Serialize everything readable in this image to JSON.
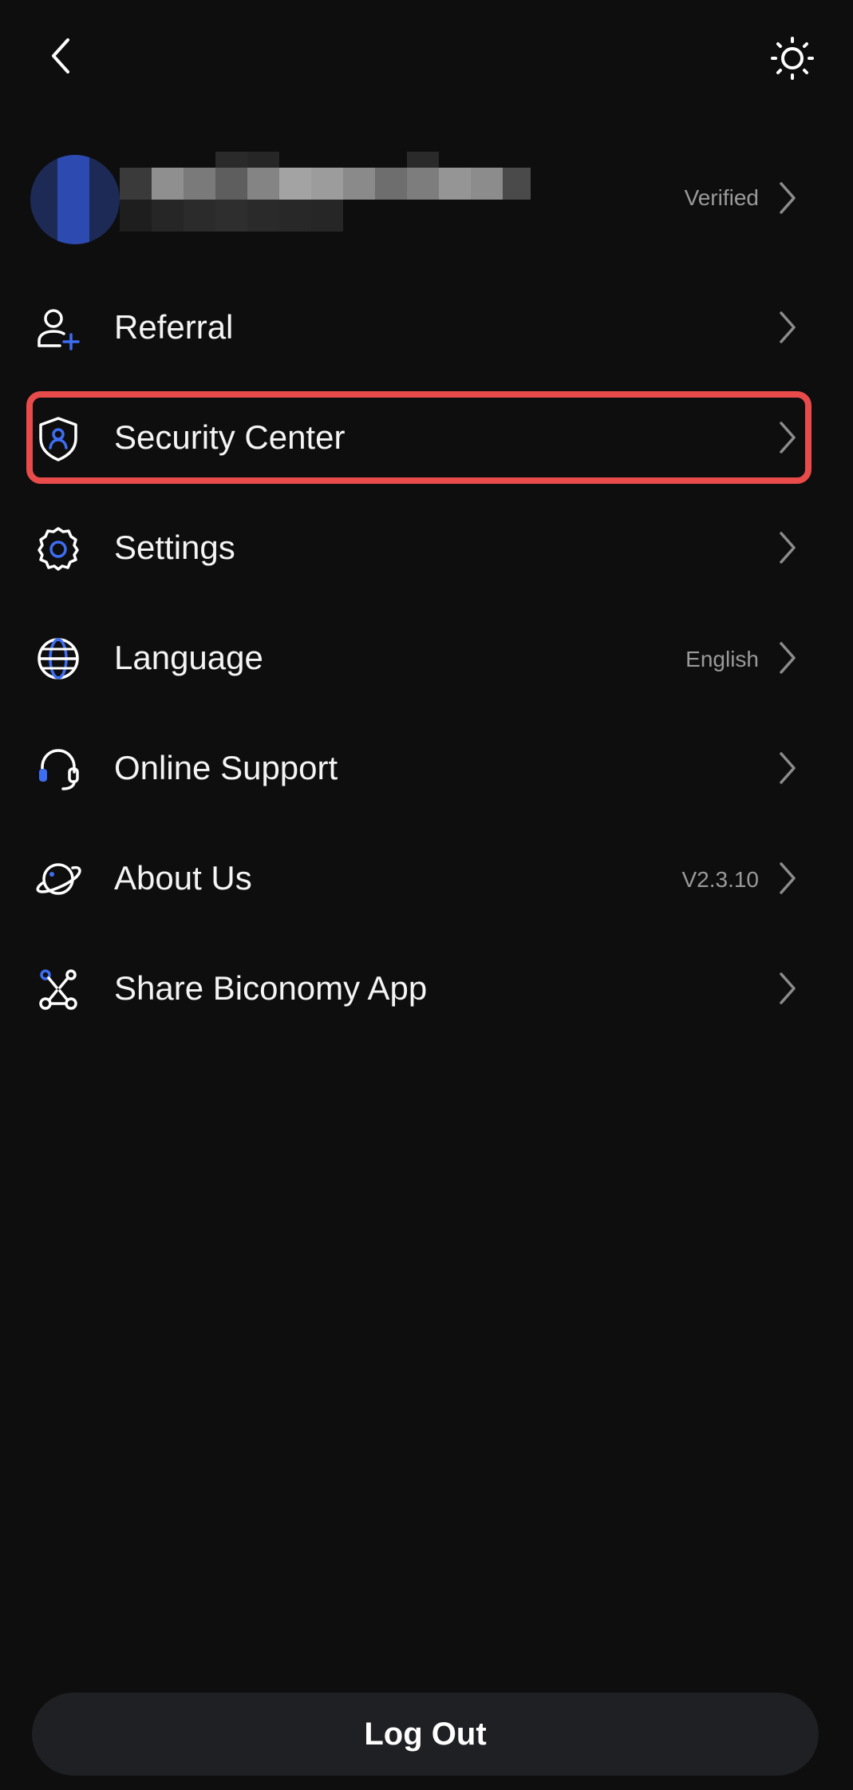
{
  "header": {
    "back_icon": "chevron-left-icon",
    "theme_icon": "sun-icon"
  },
  "profile": {
    "status": "Verified",
    "avatar_color": "#2c4ab0"
  },
  "menu": {
    "items": [
      {
        "label": "Referral",
        "value": "",
        "icon": "add-user-icon"
      },
      {
        "label": "Security Center",
        "value": "",
        "icon": "shield-user-icon"
      },
      {
        "label": "Settings",
        "value": "",
        "icon": "gear-icon"
      },
      {
        "label": "Language",
        "value": "English",
        "icon": "globe-icon"
      },
      {
        "label": "Online Support",
        "value": "",
        "icon": "headset-icon"
      },
      {
        "label": "About Us",
        "value": "V2.3.10",
        "icon": "planet-icon"
      },
      {
        "label": "Share Biconomy App",
        "value": "",
        "icon": "share-nodes-icon"
      }
    ]
  },
  "logout": {
    "label": "Log Out"
  },
  "colors": {
    "background": "#0e0e0f",
    "accent": "#3d6df2",
    "highlight": "#e94b4b",
    "muted_text": "#9a9a9a",
    "button_bg": "#1f2023"
  }
}
